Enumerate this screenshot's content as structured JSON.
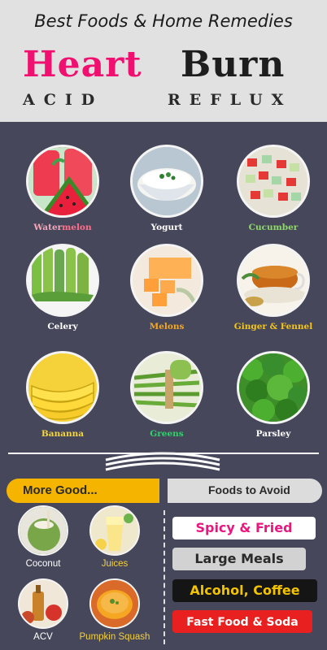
{
  "header": {
    "subtitle": "Best Foods & Home Remedies",
    "title_part1": "Heart",
    "title_part2": "Burn",
    "acid": "ACID",
    "reflux": "REFLUX"
  },
  "best_foods": [
    {
      "label": "Watermelon",
      "label_a": "Water",
      "label_b": "melon",
      "color_a": "#f3a7b8",
      "color_b": "#ff6f8a"
    },
    {
      "label": "Yogurt",
      "color": "#ffffff"
    },
    {
      "label": "Cucumber",
      "color": "#8fd86b"
    },
    {
      "label": "Celery",
      "color": "#ffffff"
    },
    {
      "label": "Melons",
      "color": "#f5a623"
    },
    {
      "label": "Ginger & Fennel",
      "color": "#f5c518"
    },
    {
      "label": "Bananna",
      "color": "#f5d63d"
    },
    {
      "label": "Greens",
      "color": "#2fd36a"
    },
    {
      "label": "Parsley",
      "color": "#ffffff"
    }
  ],
  "sections": {
    "more_good": "More Good...",
    "foods_to_avoid": "Foods to Avoid"
  },
  "more_good_items": [
    {
      "label": "Coconut",
      "color": "#ffffff"
    },
    {
      "label": "Juices",
      "color": "#f4d03f"
    },
    {
      "label": "ACV",
      "color": "#ffffff"
    },
    {
      "label": "Pumpkin Squash",
      "color": "#f4d03f"
    }
  ],
  "avoid_items": [
    {
      "label": "Spicy & Fried",
      "bg": "#ffffff",
      "fg": "#e8177f"
    },
    {
      "label": "Large Meals",
      "bg": "#d2d2d2",
      "fg": "#2a2a2a"
    },
    {
      "label": "Alcohol, Coffee",
      "bg": "#151515",
      "fg": "#f2c300"
    },
    {
      "label": "Fast Food & Soda",
      "bg": "#e82020",
      "fg": "#ffffff"
    }
  ],
  "colors": {
    "background": "#46475a",
    "header": "#e1e1e1",
    "accent_pink": "#f0106f",
    "accent_yellow": "#f4b400"
  },
  "icons": [
    "watermelon-image",
    "yogurt-image",
    "cucumber-image",
    "celery-image",
    "melon-image",
    "ginger-tea-image",
    "banana-image",
    "green-beans-image",
    "parsley-image",
    "coconut-image",
    "juice-image",
    "acv-image",
    "pumpkin-soup-image"
  ]
}
